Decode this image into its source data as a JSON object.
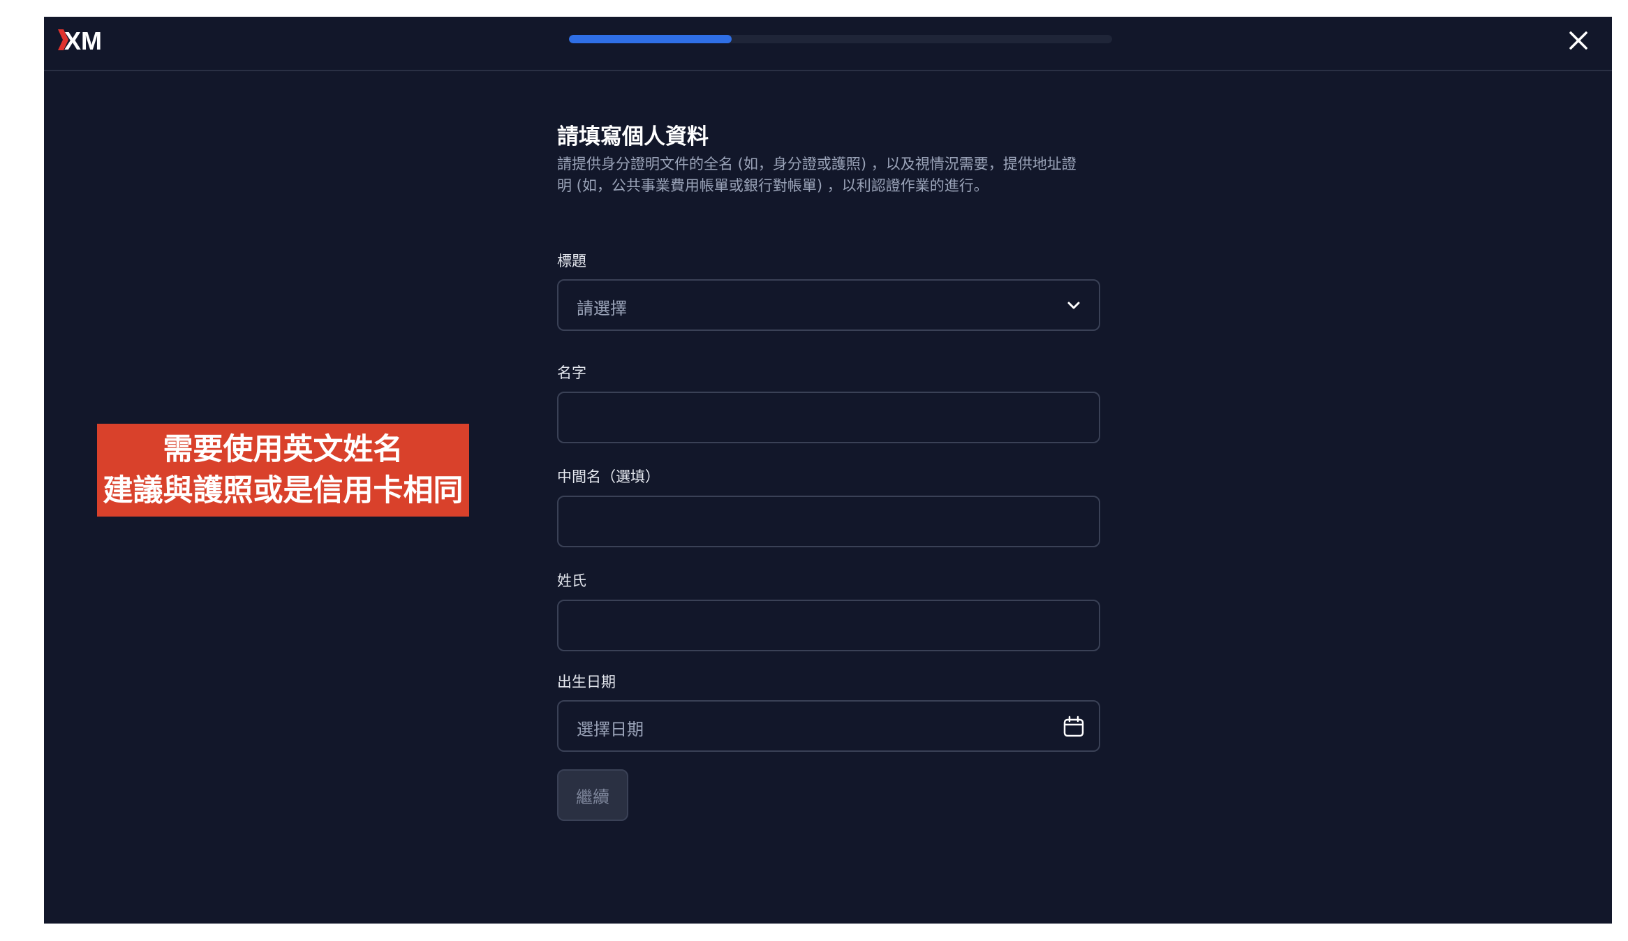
{
  "header": {
    "logo_text": "XM",
    "progress_percent": 30,
    "close_icon": "close-icon"
  },
  "form": {
    "title": "請填寫個人資料",
    "description_line1": "請提供身分證明文件的全名 (如，身分證或護照) ，以及視情況需要，提供地址證",
    "description_line2": "明 (如，公共事業費用帳單或銀行對帳單) ，以利認證作業的進行。",
    "fields": {
      "title_select": {
        "label": "標題",
        "placeholder": "請選擇",
        "icon": "chevron-down-icon"
      },
      "first_name": {
        "label": "名字",
        "value": ""
      },
      "middle_name": {
        "label": "中間名（選填）",
        "value": ""
      },
      "last_name": {
        "label": "姓氏",
        "value": ""
      },
      "birth_date": {
        "label": "出生日期",
        "placeholder": "選擇日期",
        "icon": "calendar-icon"
      }
    },
    "continue_label": "繼續"
  },
  "annotation": {
    "line1": "需要使用英文姓名",
    "line2": "建議與護照或是信用卡相同"
  },
  "colors": {
    "background": "#12172a",
    "accent": "#2f6fe6",
    "annotation": "#d9412b",
    "logo_red": "#e0322d"
  }
}
